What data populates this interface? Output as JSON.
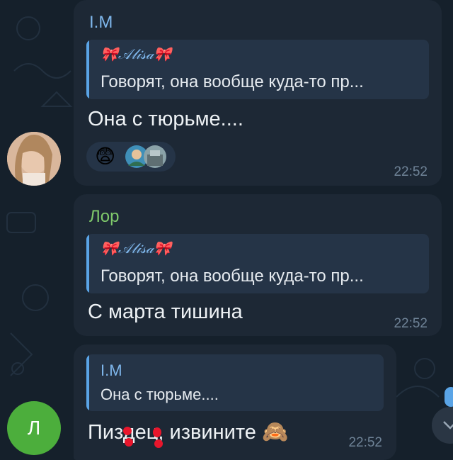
{
  "colors": {
    "background": "#15202b",
    "bubble": "#1d2835",
    "quote_bg": "#253447",
    "quote_bar": "#5aa4e6",
    "name_blue": "#7fb7ec",
    "name_green": "#7fc96b",
    "time": "#6f8397",
    "avatar_green": "#4cae3c"
  },
  "messages": [
    {
      "sender": "I.M",
      "quote_title": "🎀𝒜𝓁𝒾𝓈𝒶🎀",
      "quote_text": "Говорят, она вообще куда-то пр...",
      "text": "Она с тюрьме....",
      "time": "22:52",
      "reactions": [
        "😨",
        "sticker-avatar-icon",
        "sticker-avatar-icon"
      ]
    },
    {
      "sender": "Лор",
      "quote_title": "🎀𝒜𝓁𝒾𝓈𝒶🎀",
      "quote_text": "Говорят, она вообще куда-то пр...",
      "text": "С марта тишина",
      "time": "22:52"
    },
    {
      "sender": "",
      "quote_title": "I.M",
      "quote_text": "Она с тюрьме....",
      "text_before": "Пи",
      "text_censored_1": "з",
      "text_mid": "д",
      "text_censored_2": "е",
      "text_after": "ц, извините",
      "emoji": "🙈",
      "time": "22:52",
      "avatar_letter": "Л"
    }
  ]
}
